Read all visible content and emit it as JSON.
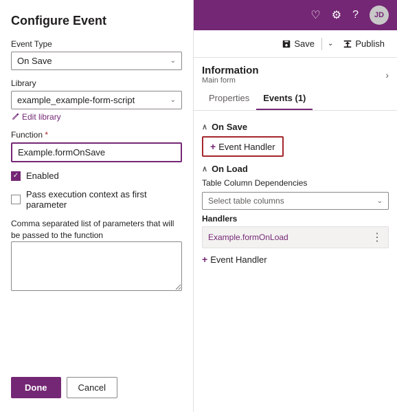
{
  "leftPanel": {
    "title": "Configure Event",
    "eventType": {
      "label": "Event Type",
      "value": "On Save"
    },
    "library": {
      "label": "Library",
      "value": "example_example-form-script",
      "editLabel": "Edit library"
    },
    "function": {
      "label": "Function",
      "required": true,
      "value": "Example.formOnSave"
    },
    "enabled": {
      "label": "Enabled",
      "checked": true
    },
    "passContext": {
      "label": "Pass execution context as first parameter",
      "checked": false
    },
    "params": {
      "label": "Comma separated list of parameters that will be passed to the function"
    },
    "buttons": {
      "done": "Done",
      "cancel": "Cancel"
    }
  },
  "topBar": {
    "avatarLabel": "JD"
  },
  "actionBar": {
    "save": "Save",
    "publish": "Publish"
  },
  "rightPanel": {
    "info": {
      "title": "Information",
      "subtitle": "Main form"
    },
    "tabs": [
      {
        "label": "Properties",
        "active": false
      },
      {
        "label": "Events (1)",
        "active": true
      }
    ],
    "sections": {
      "onSave": {
        "title": "On Save",
        "eventHandlerBtn": "Event Handler"
      },
      "onLoad": {
        "title": "On Load",
        "tableColumnDeps": "Table Column Dependencies",
        "selectPlaceholder": "Select table columns",
        "handlersLabel": "Handlers",
        "handlerValue": "Example.formOnLoad",
        "eventHandlerBtn": "Event Handler"
      }
    }
  }
}
